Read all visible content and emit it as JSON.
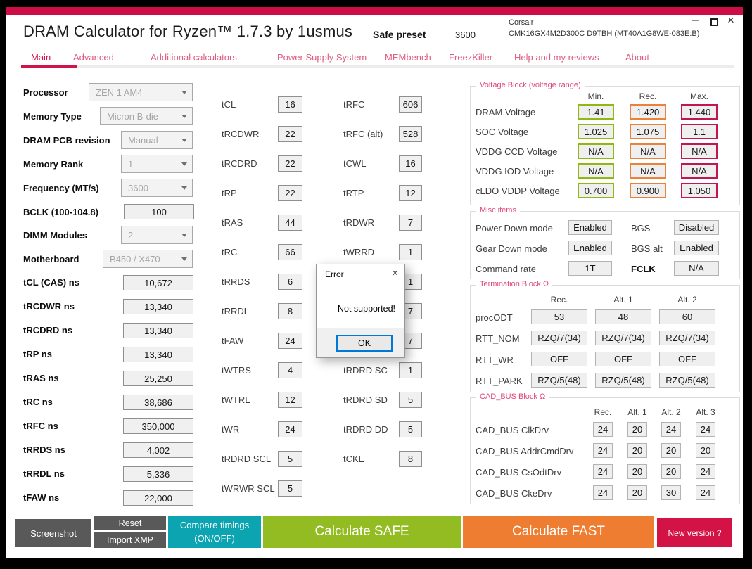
{
  "header": {
    "title": "DRAM Calculator for Ryzen™ 1.7.3 by 1usmus",
    "preset_label": "Safe preset",
    "preset_value": "3600",
    "module_vendor": "Corsair",
    "module_part": "CMK16GX4M2D300C D9TBH (MT40A1G8WE-083E:B)"
  },
  "window_controls": {
    "minimize": "–",
    "close": "×"
  },
  "nav": {
    "tabs": [
      "Main",
      "Advanced",
      "Additional calculators",
      "Power Supply System",
      "MEMbench",
      "FreezKiller",
      "Help and my reviews",
      "About"
    ]
  },
  "left": {
    "fields": [
      {
        "label": "Processor",
        "value": "ZEN 1 AM4"
      },
      {
        "label": "Memory Type",
        "value": "Micron B-die"
      },
      {
        "label": "DRAM PCB revision",
        "value": "Manual"
      },
      {
        "label": "Memory Rank",
        "value": "1"
      },
      {
        "label": "Frequency (MT/s)",
        "value": "3600"
      },
      {
        "label": "BCLK (100-104.8)",
        "value": "100"
      },
      {
        "label": "DIMM Modules",
        "value": "2"
      },
      {
        "label": "Motherboard",
        "value": "B450 / X470"
      }
    ],
    "ns_fields": [
      {
        "label": "tCL (CAS) ns",
        "value": "10,672"
      },
      {
        "label": "tRCDWR ns",
        "value": "13,340"
      },
      {
        "label": "tRCDRD ns",
        "value": "13,340"
      },
      {
        "label": "tRP ns",
        "value": "13,340"
      },
      {
        "label": "tRAS ns",
        "value": "25,250"
      },
      {
        "label": "tRC ns",
        "value": "38,686"
      },
      {
        "label": "tRFC ns",
        "value": "350,000"
      },
      {
        "label": "tRRDS ns",
        "value": "4,002"
      },
      {
        "label": "tRRDL ns",
        "value": "5,336"
      },
      {
        "label": "tFAW ns",
        "value": "22,000"
      }
    ]
  },
  "timings": {
    "col1": [
      {
        "label": "tCL",
        "value": "16"
      },
      {
        "label": "tRCDWR",
        "value": "22"
      },
      {
        "label": "tRCDRD",
        "value": "22"
      },
      {
        "label": "tRP",
        "value": "22"
      },
      {
        "label": "tRAS",
        "value": "44"
      },
      {
        "label": "tRC",
        "value": "66"
      },
      {
        "label": "tRRDS",
        "value": "6"
      },
      {
        "label": "tRRDL",
        "value": "8"
      },
      {
        "label": "tFAW",
        "value": "24"
      },
      {
        "label": "tWTRS",
        "value": "4"
      },
      {
        "label": "tWTRL",
        "value": "12"
      },
      {
        "label": "tWR",
        "value": "24"
      },
      {
        "label": "tRDRD SCL",
        "value": "5"
      },
      {
        "label": "tWRWR SCL",
        "value": "5"
      }
    ],
    "col2": [
      {
        "label": "tRFC",
        "value": "606"
      },
      {
        "label": "tRFC (alt)",
        "value": "528"
      },
      {
        "label": "tCWL",
        "value": "16"
      },
      {
        "label": "tRTP",
        "value": "12"
      },
      {
        "label": "tRDWR",
        "value": "7"
      },
      {
        "label": "tWRRD",
        "value": "1"
      },
      {
        "label": "",
        "value": "1"
      },
      {
        "label": "",
        "value": "7"
      },
      {
        "label": "",
        "value": "7"
      },
      {
        "label": "tRDRD SC",
        "value": "1"
      },
      {
        "label": "tRDRD SD",
        "value": "5"
      },
      {
        "label": "tRDRD DD",
        "value": "5"
      },
      {
        "label": "tCKE",
        "value": "8"
      }
    ]
  },
  "dialog": {
    "title": "Error",
    "message": "Not supported!",
    "ok_label": "OK",
    "close_icon": "×"
  },
  "voltage_block": {
    "title": "Voltage Block (voltage range)",
    "headers": [
      "Min.",
      "Rec.",
      "Max."
    ],
    "rows": [
      {
        "label": "DRAM Voltage",
        "min": "1.41",
        "rec": "1.420",
        "max": "1.440"
      },
      {
        "label": "SOC Voltage",
        "min": "1.025",
        "rec": "1.075",
        "max": "1.1"
      },
      {
        "label": "VDDG  CCD Voltage",
        "min": "N/A",
        "rec": "N/A",
        "max": "N/A"
      },
      {
        "label": "VDDG  IOD Voltage",
        "min": "N/A",
        "rec": "N/A",
        "max": "N/A"
      },
      {
        "label": "cLDO VDDP Voltage",
        "min": "0.700",
        "rec": "0.900",
        "max": "1.050"
      }
    ]
  },
  "misc_items": {
    "title": "Misc items",
    "rows": [
      {
        "label_left": "Power Down mode",
        "value_left": "Enabled",
        "label_right": "BGS",
        "value_right": "Disabled"
      },
      {
        "label_left": "Gear Down mode",
        "value_left": "Enabled",
        "label_right": "BGS alt",
        "value_right": "Enabled"
      },
      {
        "label_left": "Command rate",
        "value_left": "1T",
        "label_right": "FCLK",
        "value_right": "N/A"
      }
    ]
  },
  "termination_block": {
    "title": "Termination Block Ω",
    "headers": [
      "Rec.",
      "Alt. 1",
      "Alt. 2"
    ],
    "rows": [
      {
        "label": "procODT",
        "v0": "53",
        "v1": "48",
        "v2": "60"
      },
      {
        "label": "RTT_NOM",
        "v0": "RZQ/7(34)",
        "v1": "RZQ/7(34)",
        "v2": "RZQ/7(34)"
      },
      {
        "label": "RTT_WR",
        "v0": "OFF",
        "v1": "OFF",
        "v2": "OFF"
      },
      {
        "label": "RTT_PARK",
        "v0": "RZQ/5(48)",
        "v1": "RZQ/5(48)",
        "v2": "RZQ/5(48)"
      }
    ]
  },
  "cad_bus_block": {
    "title": "CAD_BUS Block Ω",
    "headers": [
      "Rec.",
      "Alt. 1",
      "Alt. 2",
      "Alt. 3"
    ],
    "rows": [
      {
        "label": "CAD_BUS ClkDrv",
        "v0": "24",
        "v1": "20",
        "v2": "24",
        "v3": "24"
      },
      {
        "label": "CAD_BUS AddrCmdDrv",
        "v0": "24",
        "v1": "20",
        "v2": "20",
        "v3": "20"
      },
      {
        "label": "CAD_BUS CsOdtDrv",
        "v0": "24",
        "v1": "20",
        "v2": "20",
        "v3": "24"
      },
      {
        "label": "CAD_BUS CkeDrv",
        "v0": "24",
        "v1": "20",
        "v2": "30",
        "v3": "24"
      }
    ]
  },
  "footer": {
    "screenshot": "Screenshot",
    "reset": "Reset",
    "import_xmp": "Import XMP",
    "compare_line1": "Compare timings",
    "compare_line2": "(ON/OFF)",
    "calc_safe": "Calculate SAFE",
    "calc_fast": "Calculate FAST",
    "new_version": "New version ?"
  },
  "colors": {
    "brand_crimson": "#d1134b",
    "title_strip": "#cf0d45",
    "tab_pink": "#e05c80",
    "legend_pink": "#e2477a",
    "voltage_min_green": "#8fb811",
    "voltage_rec_orange": "#e8823c",
    "voltage_max_crimson": "#c11652",
    "compare_teal": "#0da4b2",
    "calc_safe_green": "#93bc22",
    "calc_fast_orange": "#ee7d31",
    "dark_button_gray": "#595959",
    "ok_focus_blue": "#0078d7"
  }
}
